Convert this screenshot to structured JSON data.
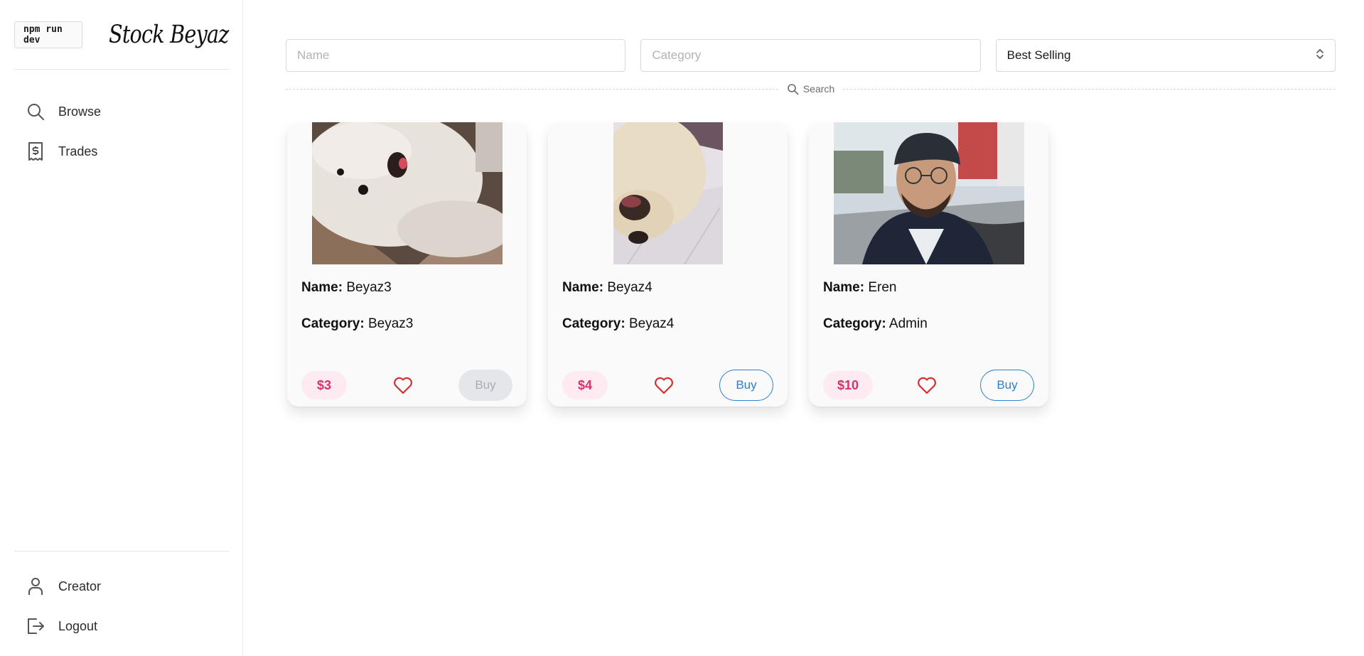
{
  "sidebar": {
    "badge": "npm run dev",
    "brand": "Stock Beyaz",
    "nav_top": [
      {
        "label": "Browse",
        "icon": "search-icon"
      },
      {
        "label": "Trades",
        "icon": "receipt-dollar-icon"
      }
    ],
    "nav_bottom": [
      {
        "label": "Creator",
        "icon": "user-icon"
      },
      {
        "label": "Logout",
        "icon": "logout-icon"
      }
    ]
  },
  "filters": {
    "name_placeholder": "Name",
    "category_placeholder": "Category",
    "sort_value": "Best Selling",
    "search_label": "Search"
  },
  "labels": {
    "name": "Name:",
    "category": "Category:",
    "buy": "Buy"
  },
  "cards": [
    {
      "name": "Beyaz3",
      "category": "Beyaz3",
      "price": "$3",
      "buy_enabled": false,
      "image": "white dog lying on rug"
    },
    {
      "name": "Beyaz4",
      "category": "Beyaz4",
      "price": "$4",
      "buy_enabled": true,
      "image": "white dog sleeping on tiles"
    },
    {
      "name": "Eren",
      "category": "Admin",
      "price": "$10",
      "buy_enabled": true,
      "image": "man with cap and glasses selfie"
    }
  ],
  "colors": {
    "price_text": "#d6336c",
    "price_bg": "#fdebf1",
    "buy_accent": "#2f7fd1",
    "heart": "#d32f2f"
  }
}
